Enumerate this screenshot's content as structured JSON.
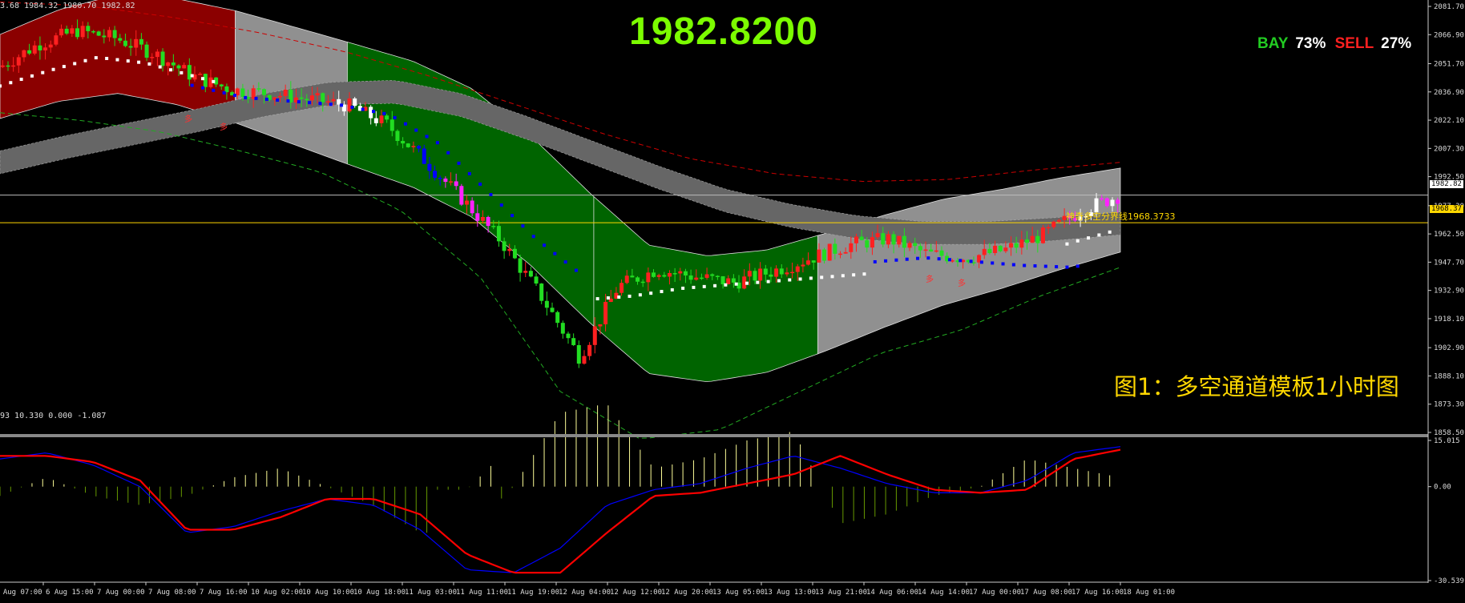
{
  "header": {
    "main_ohlc": "3.68 1984.32 1980.70 1982.82",
    "osc_values": "93 10.330 0.000 -1.087"
  },
  "current_price": "1982.8200",
  "sentiment": {
    "bay_label": "BAY",
    "bay_pct": "73%",
    "sell_label": "SELL",
    "sell_pct": "27%"
  },
  "caption": "图1：多空通道模板1小时图",
  "pivot_label": "神奇多空分界线1968.3733",
  "badges": {
    "price": "1982.82",
    "pivot": "1968.37"
  },
  "signal_marks": [
    "多",
    "多",
    "多",
    "多"
  ],
  "colors": {
    "background": "#000000",
    "bull_candle": "#FF2020",
    "bear_candle": "#22DD22",
    "ext_bull_candle": "#FFFFFF",
    "ext_bear_candle": "#FF22FF",
    "red_zone": "#8B0000",
    "green_zone": "#006400",
    "gray_zone": "#909090",
    "dark_band": "#666666",
    "ma_blue": "#0000FF",
    "ma_white": "#FFFFFF",
    "macd_signal": "#FF0000",
    "macd_line": "#0000FF",
    "hist_up": "#FFFF99",
    "hist_down": "#669900",
    "price_line": "#FFD700",
    "big_price": "#7CFC00"
  },
  "chart_data": [
    {
      "type": "candlestick",
      "title": "",
      "x": [
        "6 Aug 07:00",
        "6 Aug 15:00",
        "7 Aug 00:00",
        "7 Aug 08:00",
        "7 Aug 16:00",
        "10 Aug 02:00",
        "10 Aug 10:00",
        "10 Aug 18:00",
        "11 Aug 03:00",
        "11 Aug 11:00",
        "11 Aug 19:00",
        "12 Aug 04:00",
        "12 Aug 12:00",
        "12 Aug 20:00",
        "13 Aug 05:00",
        "13 Aug 13:00",
        "13 Aug 21:00",
        "14 Aug 06:00",
        "14 Aug 14:00",
        "17 Aug 00:00",
        "17 Aug 08:00",
        "17 Aug 16:00",
        "18 Aug 01:00"
      ],
      "y_ticks": [
        "2081.70",
        "2066.90",
        "2051.70",
        "2036.90",
        "2022.10",
        "2007.30",
        "1992.50",
        "1977.30",
        "1962.50",
        "1947.70",
        "1932.90",
        "1918.10",
        "1902.90",
        "1888.10",
        "1873.30",
        "1858.50"
      ],
      "ylim": [
        1858.5,
        2081.7
      ],
      "close_path": [
        2050,
        2062,
        2069,
        2065,
        2057,
        2045,
        2038,
        2036,
        2033,
        2030,
        2020,
        2001,
        1980,
        1958,
        1930,
        1898,
        1935,
        1944,
        1940,
        1937,
        1943,
        1950,
        1957,
        1960,
        1952,
        1950,
        1954,
        1962,
        1975,
        1982.82
      ],
      "channel_center": [
        2045,
        2056,
        2062,
        2058,
        2050,
        2040,
        2030,
        2020,
        2005,
        1980,
        1950,
        1923,
        1918,
        1922,
        1932,
        1943,
        1953,
        1960,
        1968,
        1975
      ],
      "current_price": 1982.82,
      "pivot_line": 1968.3733
    },
    {
      "type": "macd",
      "y_ticks": [
        "15.015",
        "0.00",
        "-30.539"
      ],
      "ylim": [
        -30.539,
        15.015
      ],
      "signal_line": [
        10,
        10,
        8,
        2,
        -14,
        -14,
        -10,
        -4,
        -4,
        -9,
        -22,
        -28,
        -28,
        -15,
        -3,
        -2,
        1,
        4,
        10,
        4,
        -1,
        -2,
        -1,
        9,
        12
      ],
      "macd_line": [
        9,
        11,
        7,
        0,
        -15,
        -13,
        -8,
        -4,
        -6,
        -14,
        -27,
        -28,
        -20,
        -6,
        -1,
        1,
        6,
        10,
        6,
        1,
        -2,
        -2,
        2,
        11,
        13
      ]
    }
  ]
}
